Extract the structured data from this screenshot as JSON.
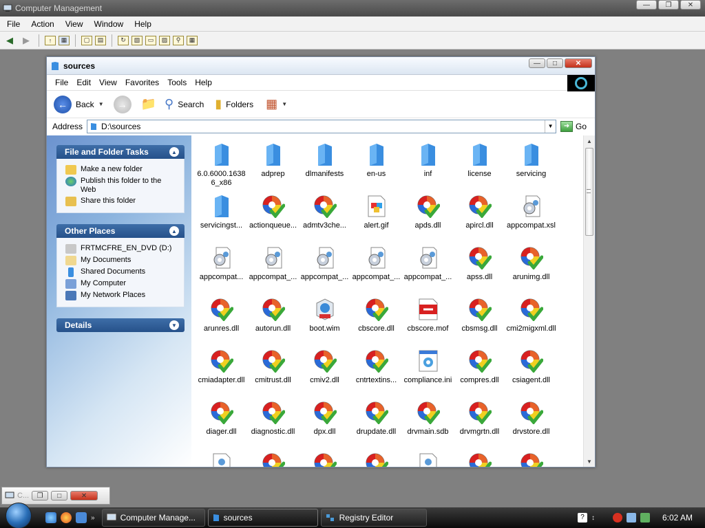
{
  "outer": {
    "title": "Computer Management",
    "menu": [
      "File",
      "Action",
      "View",
      "Window",
      "Help"
    ]
  },
  "explorer": {
    "title": "sources",
    "menu": [
      "File",
      "Edit",
      "View",
      "Favorites",
      "Tools",
      "Help"
    ],
    "toolbar": {
      "back": "Back",
      "search": "Search",
      "folders": "Folders"
    },
    "address": {
      "label": "Address",
      "value": "D:\\sources",
      "go": "Go"
    },
    "tasks": {
      "file_folder": {
        "title": "File and Folder Tasks",
        "items": [
          "Make a new folder",
          "Publish this folder to the Web",
          "Share this folder"
        ]
      },
      "other_places": {
        "title": "Other Places",
        "items": [
          "FRTMCFRE_EN_DVD (D:)",
          "My Documents",
          "Shared Documents",
          "My Computer",
          "My Network Places"
        ]
      },
      "details": {
        "title": "Details"
      }
    },
    "files": [
      {
        "name": "6.0.6000.16386_x86",
        "type": "folder"
      },
      {
        "name": "adprep",
        "type": "folder"
      },
      {
        "name": "dlmanifests",
        "type": "folder"
      },
      {
        "name": "en-us",
        "type": "folder"
      },
      {
        "name": "inf",
        "type": "folder"
      },
      {
        "name": "license",
        "type": "folder"
      },
      {
        "name": "servicing",
        "type": "folder"
      },
      {
        "name": "servicingst...",
        "type": "folder"
      },
      {
        "name": "actionqueue...",
        "type": "dll"
      },
      {
        "name": "admtv3che...",
        "type": "dll"
      },
      {
        "name": "alert.gif",
        "type": "gif"
      },
      {
        "name": "apds.dll",
        "type": "dll"
      },
      {
        "name": "apircl.dll",
        "type": "dll"
      },
      {
        "name": "appcompat.xsl",
        "type": "xsl"
      },
      {
        "name": "appcompat...",
        "type": "xsl"
      },
      {
        "name": "appcompat_...",
        "type": "xsl"
      },
      {
        "name": "appcompat_...",
        "type": "xsl"
      },
      {
        "name": "appcompat_...",
        "type": "xsl"
      },
      {
        "name": "appcompat_...",
        "type": "xsl"
      },
      {
        "name": "apss.dll",
        "type": "dll"
      },
      {
        "name": "arunimg.dll",
        "type": "dll"
      },
      {
        "name": "arunres.dll",
        "type": "dll"
      },
      {
        "name": "autorun.dll",
        "type": "dll"
      },
      {
        "name": "boot.wim",
        "type": "wim"
      },
      {
        "name": "cbscore.dll",
        "type": "dll"
      },
      {
        "name": "cbscore.mof",
        "type": "mof"
      },
      {
        "name": "cbsmsg.dll",
        "type": "dll"
      },
      {
        "name": "cmi2migxml.dll",
        "type": "dll"
      },
      {
        "name": "cmiadapter.dll",
        "type": "dll"
      },
      {
        "name": "cmitrust.dll",
        "type": "dll"
      },
      {
        "name": "cmiv2.dll",
        "type": "dll"
      },
      {
        "name": "cntrtextins...",
        "type": "dll"
      },
      {
        "name": "compliance.ini",
        "type": "ini"
      },
      {
        "name": "compres.dll",
        "type": "dll"
      },
      {
        "name": "csiagent.dll",
        "type": "dll"
      },
      {
        "name": "diager.dll",
        "type": "dll"
      },
      {
        "name": "diagnostic.dll",
        "type": "dll"
      },
      {
        "name": "dpx.dll",
        "type": "dll"
      },
      {
        "name": "drupdate.dll",
        "type": "dll"
      },
      {
        "name": "drvmain.sdb",
        "type": "dll"
      },
      {
        "name": "drvmgrtn.dll",
        "type": "dll"
      },
      {
        "name": "drvstore.dll",
        "type": "dll"
      },
      {
        "name": "",
        "type": "doc"
      },
      {
        "name": "",
        "type": "dll"
      },
      {
        "name": "",
        "type": "dll"
      },
      {
        "name": "",
        "type": "dll"
      },
      {
        "name": "",
        "type": "doc"
      },
      {
        "name": "",
        "type": "dll"
      },
      {
        "name": "",
        "type": "dll"
      }
    ]
  },
  "minimized": {
    "title": "C..."
  },
  "taskbar": {
    "tasks": [
      "Computer Manage...",
      "sources",
      "Registry Editor"
    ],
    "clock": "6:02 AM"
  },
  "colors": {
    "folder": "#3a8ee0",
    "dll_orange": "#e8622a",
    "dll_green": "#3aa83a",
    "accent": "#26518a"
  }
}
